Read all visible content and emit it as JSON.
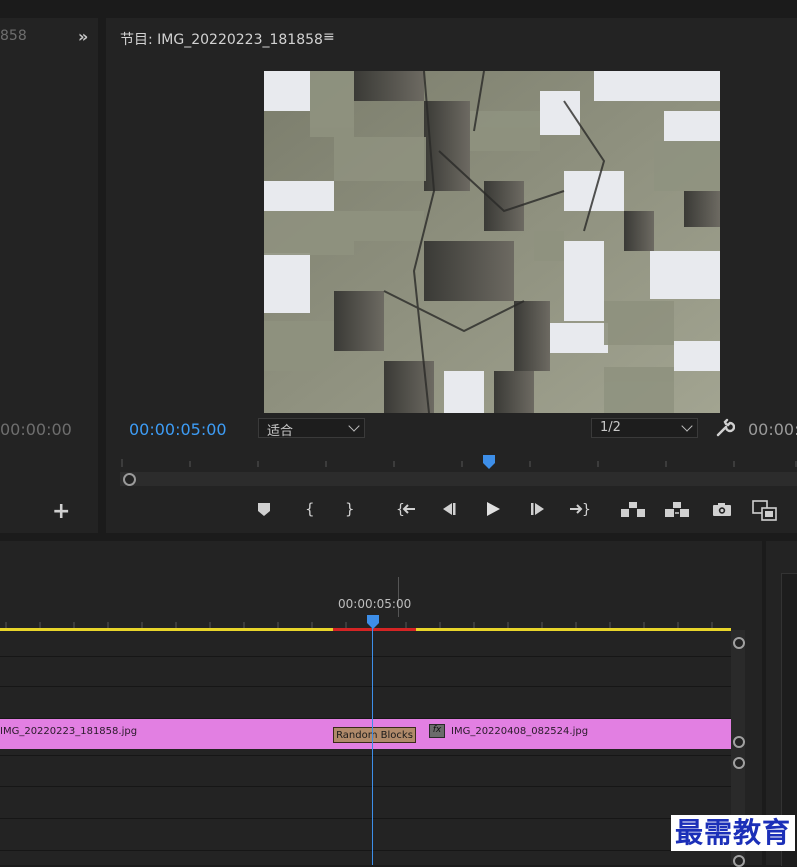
{
  "source_monitor": {
    "tab_text_partial": "858",
    "timecode_partial": "00:00:00"
  },
  "program_monitor": {
    "title": "节目: IMG_20220223_181858",
    "menu_glyph": "≡",
    "playhead_timecode": "00:00:05:00",
    "fit_select": {
      "value": "适合"
    },
    "resolution_select": {
      "value": "1/2"
    },
    "duration_timecode_partial": "00:00:",
    "controls": [
      {
        "name": "add-marker-button",
        "icon": "marker-icon"
      },
      {
        "name": "mark-in-button",
        "icon": "mark-in-icon"
      },
      {
        "name": "mark-out-button",
        "icon": "mark-out-icon"
      },
      {
        "name": "go-to-in-button",
        "icon": "go-to-in-icon"
      },
      {
        "name": "step-back-button",
        "icon": "step-back-icon"
      },
      {
        "name": "play-button",
        "icon": "play-icon"
      },
      {
        "name": "step-forward-button",
        "icon": "step-forward-icon"
      },
      {
        "name": "go-to-out-button",
        "icon": "go-to-out-icon"
      },
      {
        "name": "lift-button",
        "icon": "lift-icon"
      },
      {
        "name": "extract-button",
        "icon": "extract-icon"
      },
      {
        "name": "export-frame-button",
        "icon": "camera-icon"
      },
      {
        "name": "comparison-view-button",
        "icon": "comparison-icon"
      }
    ]
  },
  "timeline": {
    "playhead_timecode": "00:00:05:00",
    "clip_1_label": "IMG_20220223_181858.jpg",
    "clip_2_label": "IMG_20220408_082524.jpg",
    "transition_label": "Random Blocks",
    "fx_badge": "fx",
    "colors": {
      "clip": "#e27fe2",
      "work_area": "#e8d52a",
      "render_needed": "#d42424",
      "playhead": "#3d8ee8"
    }
  },
  "watermark": "最需教育"
}
